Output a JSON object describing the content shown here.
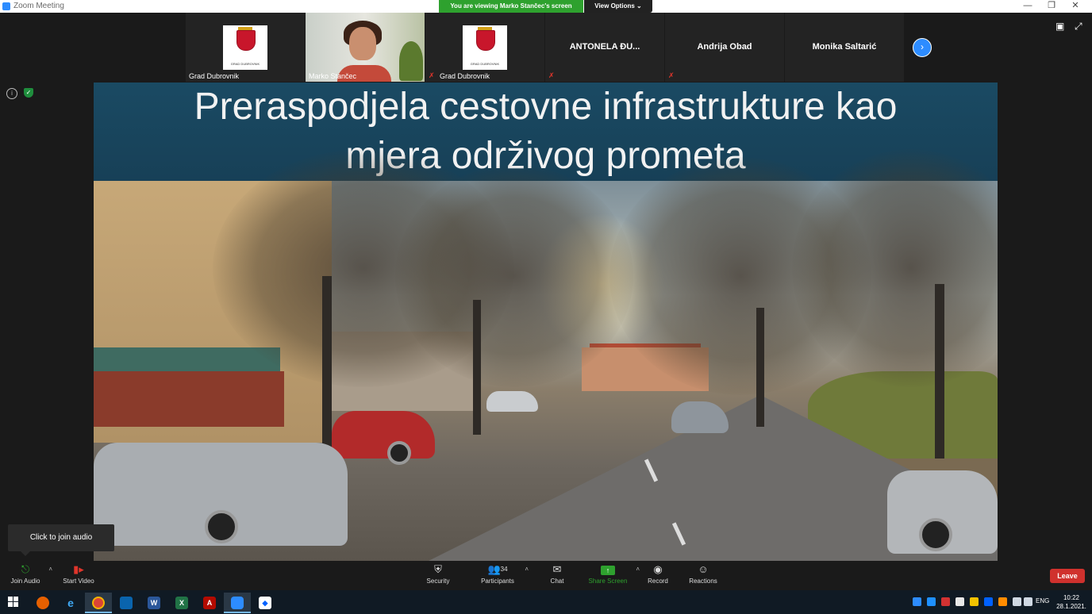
{
  "window": {
    "title": "Zoom Meeting"
  },
  "banner": {
    "viewing": "You are viewing Marko Stančec's screen",
    "view_options": "View Options"
  },
  "participants_strip": [
    {
      "name": "Grad Dubrovnik",
      "kind": "crest",
      "crest_text": "GRAD DUBROVNIK",
      "muted": false
    },
    {
      "name": "Marko Stančec",
      "kind": "video",
      "muted": false,
      "active": true
    },
    {
      "name": "Grad Dubrovnik",
      "kind": "crest",
      "crest_text": "GRAD DUBROVNIK",
      "muted": true
    },
    {
      "display": "ANTONELA ĐU...",
      "kind": "name",
      "muted": true
    },
    {
      "display": "Andrija Obad",
      "kind": "name",
      "muted": true
    },
    {
      "display": "Monika Saltarić",
      "kind": "name",
      "muted": false
    }
  ],
  "slide": {
    "title_line1": "Preraspodjela cestovne infrastrukture kao",
    "title_line2": "mjera održivog prometa"
  },
  "tooltip": {
    "text": "Click to join audio"
  },
  "toolbar": {
    "join_audio": "Join Audio",
    "start_video": "Start Video",
    "security": "Security",
    "participants": "Participants",
    "participants_count": "34",
    "chat": "Chat",
    "share_screen": "Share Screen",
    "record": "Record",
    "reactions": "Reactions",
    "leave": "Leave"
  },
  "taskbar": {
    "lang": "ENG",
    "time": "10:22",
    "date": "28.1.2021."
  },
  "colors": {
    "zoom_blue": "#2d8cff",
    "share_green": "#2ea12e",
    "leave_red": "#d0312d",
    "slide_title_bg": "#1a4a63"
  }
}
